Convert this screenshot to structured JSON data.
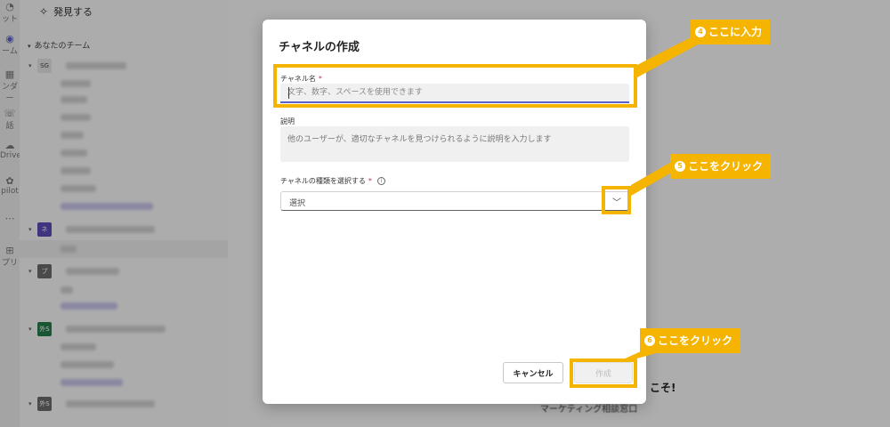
{
  "rail": {
    "items": [
      {
        "icon": "activity-icon",
        "label": "ット"
      },
      {
        "icon": "teams-icon",
        "label": "ーム"
      },
      {
        "icon": "calendar-icon",
        "label": "ンダー"
      },
      {
        "icon": "calls-icon",
        "label": "話"
      },
      {
        "icon": "onedrive-icon",
        "label": "Drive"
      },
      {
        "icon": "copilot-icon",
        "label": "pilot"
      },
      {
        "icon": "more-icon",
        "label": ""
      },
      {
        "icon": "apps-icon",
        "label": "プリ"
      }
    ]
  },
  "sidebar": {
    "discover_label": "発見する",
    "your_teams_label": "あなたのチーム",
    "teams": [
      {
        "initials": "SG",
        "color": "#e2e2e2"
      },
      {
        "initials": "ネ",
        "color": "#5b4bb7"
      },
      {
        "initials": "プ",
        "color": "#6b6b6b"
      },
      {
        "initials": "外S",
        "color": "#237b4b"
      },
      {
        "initials": "外S",
        "color": "#6b6b6b"
      }
    ]
  },
  "background": {
    "welcome_text": "こそ!",
    "subtitle_text": "マーケティング相談窓口"
  },
  "dialog": {
    "title": "チャネルの作成",
    "channel_name_label": "チャネル名",
    "required_mark": "*",
    "channel_name_placeholder": "文字、数字、スペースを使用できます",
    "description_label": "説明",
    "description_placeholder": "他のユーザーが、適切なチャネルを見つけられるように説明を入力します",
    "type_label": "チャネルの種類を選択する",
    "type_value": "選択",
    "cancel_label": "キャンセル",
    "create_label": "作成"
  },
  "annotations": {
    "step4": {
      "num": "4",
      "text": "ここに入力"
    },
    "step5": {
      "num": "5",
      "text": "ここをクリック"
    },
    "step6": {
      "num": "6",
      "text": "ここをクリック"
    },
    "color": "#f5b400"
  }
}
